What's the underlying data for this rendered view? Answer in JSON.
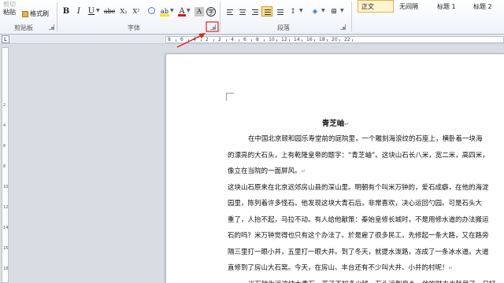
{
  "ribbon": {
    "clipboard": {
      "cut_label": "剪切",
      "paste_label": "粘贴",
      "format_painter_label": "格式刷",
      "group_label": "剪贴板"
    },
    "font": {
      "group_label": "字体",
      "bold": "B",
      "italic": "I",
      "underline": "U",
      "strike": "abc",
      "subscript": "X₂",
      "superscript": "X²",
      "font_color_letter": "A",
      "highlight_letter": "ab",
      "char_shade_letter": "A",
      "enclose_letter": "字"
    },
    "paragraph": {
      "group_label": "段落"
    },
    "styles": {
      "items": [
        "正文",
        "无间隔",
        "标题 1",
        "标题 2"
      ],
      "active_index": 0,
      "active_color": "#e2b14a"
    }
  },
  "ruler": {
    "numbers": [
      "8",
      "6",
      "4",
      "2",
      "2",
      "4",
      "6",
      "8",
      "10",
      "12",
      "14",
      "16",
      "18",
      "20",
      "22"
    ],
    "tab_selector": "L"
  },
  "vruler": {
    "numbers": [
      "2",
      "4",
      "6",
      "8",
      "10",
      "12",
      "14",
      "16",
      "18"
    ]
  },
  "document": {
    "title": "青芝岫",
    "paragraph_mark": "↵",
    "lines": [
      "在中国北京颐和园乐寿堂前的庭院里，一个雕刻海浪纹的石座上，横卧着一块海",
      "的漂亮的大石头，上有乾隆皇帝的题字：“青芝岫”。这块山石长八米，宽二米，高四米，",
      "像立在当院的一面屏风。",
      "这块山石原来在北京远郊房山县的深山里。明朝有个叫米万钟的，爱石成癖，在他的海淀",
      "园里，陈列着许多怪石。他发现这块大青石后，非常喜欢，决心运回勺园。可是石头大",
      "重了，人抬不起，马拉不动。有人给他献策：秦始皇修长城时，不是用修水道的办法搬运",
      "石的吗？米万钟觉得也只有这个办法了。於是雇了很多民工，先修起一条大路，又在路旁",
      "隔三里打一眼小井，五里打一眼大井。到了冬天，就提水泼路，冻成了一条冰水道。大道",
      "直修到了房山大石窝。今天，在房山、丰台还有不少叫大井、小井的村呢！",
      "米万钟为运这块大青石，花了不知多少钱，石头运到良乡，他的财力也耗尽了，只好"
    ],
    "line_marks": [
      false,
      false,
      true,
      false,
      false,
      false,
      false,
      false,
      true,
      false
    ]
  },
  "annotation": {
    "arrow_color": "#d9261c"
  }
}
